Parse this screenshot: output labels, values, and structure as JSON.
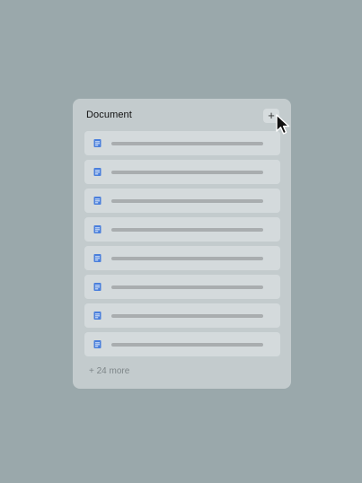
{
  "panel": {
    "title": "Document",
    "add_label": "+",
    "more_label": "+ 24 more",
    "items": [
      {
        "icon": "document-icon"
      },
      {
        "icon": "document-icon"
      },
      {
        "icon": "document-icon"
      },
      {
        "icon": "document-icon"
      },
      {
        "icon": "document-icon"
      },
      {
        "icon": "document-icon"
      },
      {
        "icon": "document-icon"
      },
      {
        "icon": "document-icon"
      }
    ]
  },
  "colors": {
    "background": "#9aa8ab",
    "panel": "#c3cbcd",
    "item": "#d4dadc",
    "doc_icon": "#4a7fdc",
    "skeleton": "#a9adaf"
  },
  "cursor": {
    "icon": "arrow-cursor-icon"
  }
}
